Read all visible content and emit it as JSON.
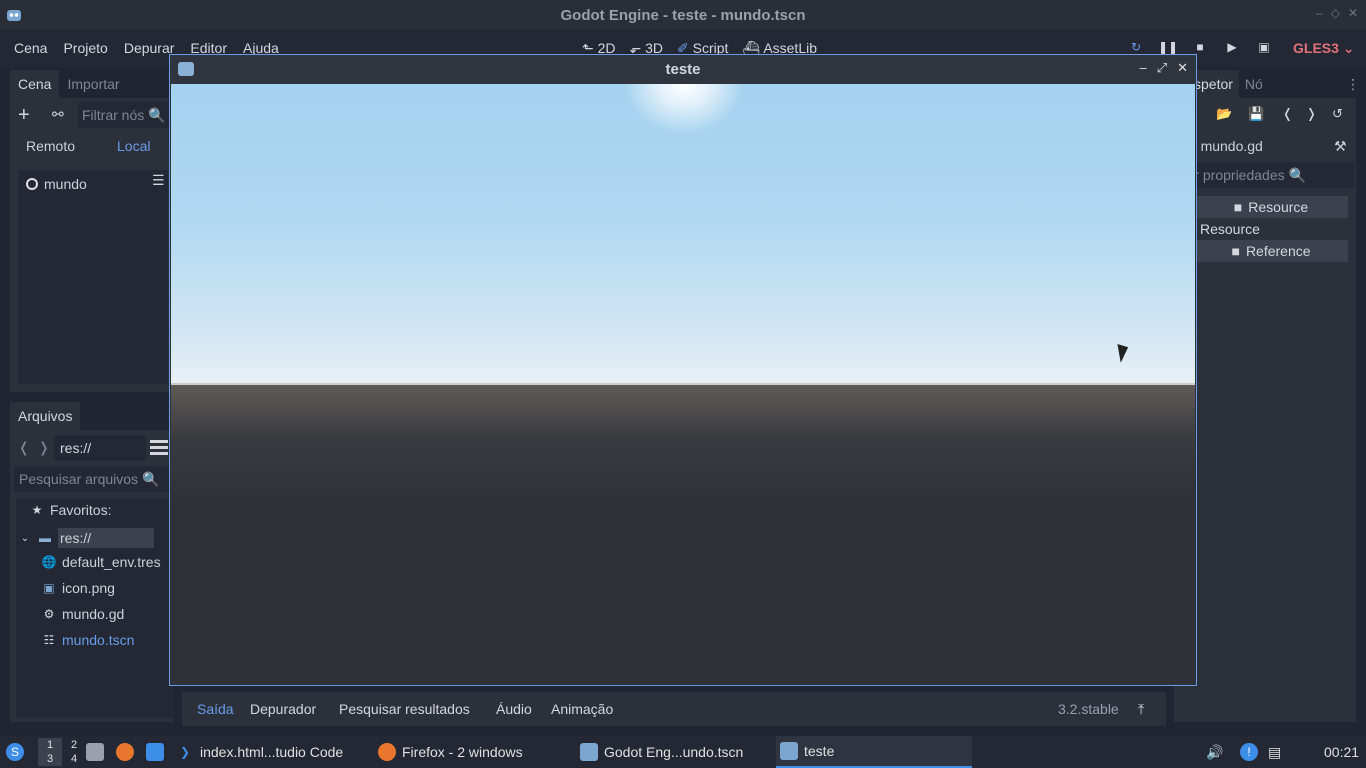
{
  "os": {
    "title": "Godot Engine - teste - mundo.tscn"
  },
  "menu": {
    "items": [
      "Cena",
      "Projeto",
      "Depurar",
      "Editor",
      "Ajuda"
    ]
  },
  "modes": {
    "m2d": "2D",
    "m3d": "3D",
    "script": "Script",
    "assetlib": "AssetLib"
  },
  "renderer": "GLES3",
  "scene_dock": {
    "tabs": [
      "Cena",
      "Importar"
    ],
    "filter_placeholder": "Filtrar nós",
    "remote": "Remoto",
    "local": "Local",
    "root_node": "mundo"
  },
  "files_dock": {
    "tab": "Arquivos",
    "path": "res://",
    "search_placeholder": "Pesquisar arquivos",
    "favorites": "Favoritos:",
    "root": "res://",
    "files": [
      "default_env.tres",
      "icon.png",
      "mundo.gd",
      "mundo.tscn"
    ]
  },
  "inspector": {
    "tabs": [
      "spetor",
      "Nó"
    ],
    "file": "mundo.gd",
    "filter_placeholder": "trar propriedades",
    "section1": "Resource",
    "label": "Resource",
    "section2": "Reference"
  },
  "bottom": {
    "tabs": [
      "Saída",
      "Depurador",
      "Pesquisar resultados",
      "Áudio",
      "Animação"
    ],
    "version": "3.2.stable"
  },
  "game_window": {
    "title": "teste"
  },
  "taskbar": {
    "desktops": [
      "1",
      "2",
      "3",
      "4"
    ],
    "items": [
      "index.html...tudio Code",
      "Firefox - 2 windows",
      "Godot Eng...undo.tscn",
      "teste"
    ],
    "clock": "00:21"
  },
  "colors": {
    "accent": "#699ce8",
    "gles": "#e0707a",
    "panel": "#2b303b",
    "background": "#202531"
  }
}
